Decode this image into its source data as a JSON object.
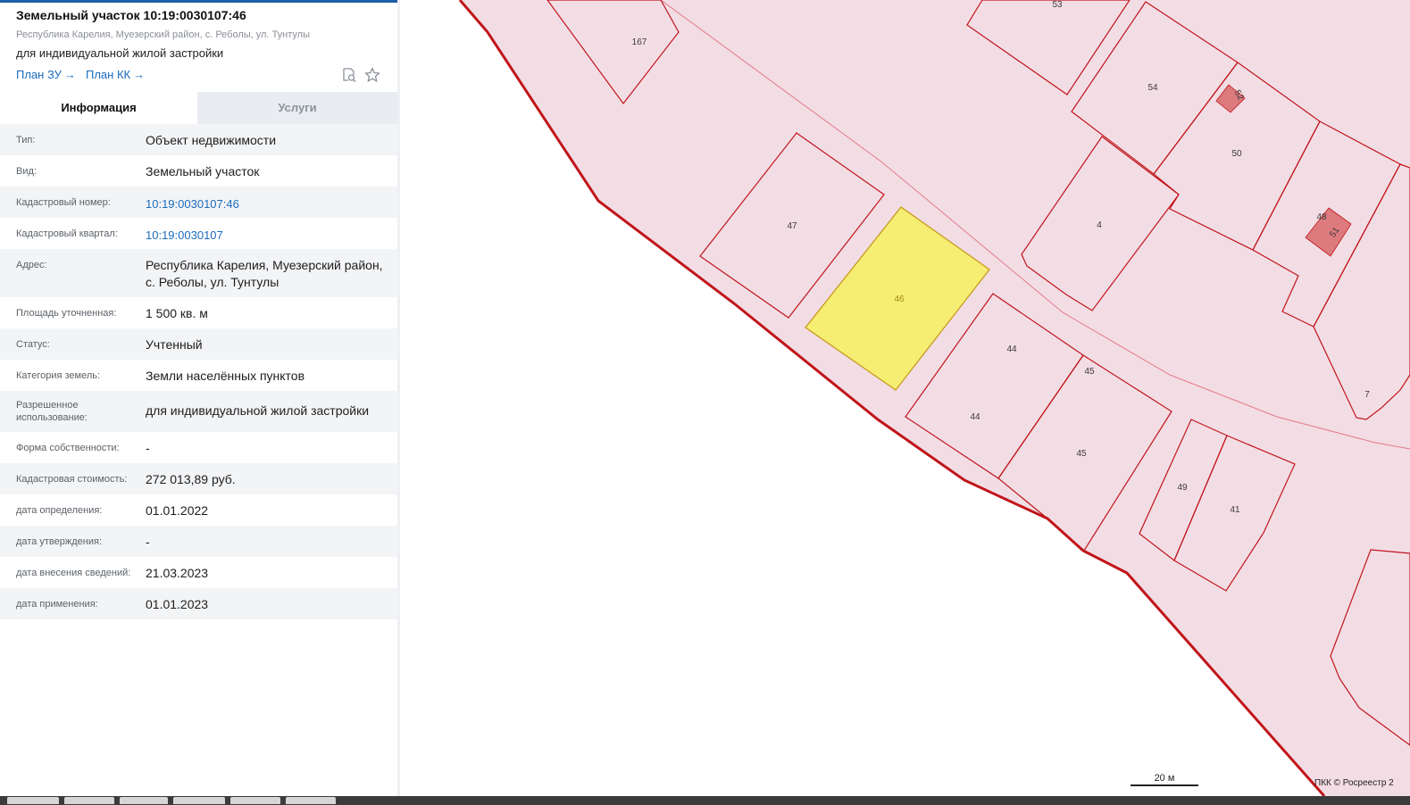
{
  "header": {
    "title": "Земельный участок 10:19:0030107:46",
    "address": "Республика Карелия, Муезерский район, с. Реболы, ул. Тунтулы",
    "use": "для индивидуальной жилой застройки",
    "link_plan_zu": "План ЗУ",
    "link_plan_kk": "План КК",
    "arrow": "→",
    "icons": [
      "search-document-icon",
      "star-icon"
    ]
  },
  "tabs": {
    "info": "Информация",
    "services": "Услуги"
  },
  "info_rows": [
    {
      "label": "Тип:",
      "value": "Объект недвижимости",
      "link": false
    },
    {
      "label": "Вид:",
      "value": "Земельный участок",
      "link": false
    },
    {
      "label": "Кадастровый номер:",
      "value": "10:19:0030107:46",
      "link": true
    },
    {
      "label": "Кадастровый квартал:",
      "value": "10:19:0030107",
      "link": true
    },
    {
      "label": "Адрес:",
      "value": "Республика Карелия, Муезерский район, с. Реболы, ул. Тунтулы",
      "link": false
    },
    {
      "label": "Площадь уточненная:",
      "value": "1 500 кв. м",
      "link": false
    },
    {
      "label": "Статус:",
      "value": "Учтенный",
      "link": false
    },
    {
      "label": "Категория земель:",
      "value": "Земли населённых пунктов",
      "link": false
    },
    {
      "label": "Разрешенное использование:",
      "value": "для индивидуальной жилой застройки",
      "link": false
    },
    {
      "label": "Форма собственности:",
      "value": "-",
      "link": false
    },
    {
      "label": "Кадастровая стоимость:",
      "value": "272 013,89 руб.",
      "link": false
    },
    {
      "label": "дата определения:",
      "value": "01.01.2022",
      "link": false
    },
    {
      "label": "дата утверждения:",
      "value": "-",
      "link": false
    },
    {
      "label": "дата внесения сведений:",
      "value": "21.03.2023",
      "link": false
    },
    {
      "label": "дата применения:",
      "value": "01.01.2023",
      "link": false
    }
  ],
  "map": {
    "plot_labels": [
      "167",
      "53",
      "54",
      "52",
      "50",
      "47",
      "46",
      "4",
      "48",
      "51",
      "44",
      "45",
      "44",
      "45",
      "7",
      "49",
      "41"
    ],
    "scale_label": "20 м",
    "copyright": "ПКК © Росреестр 2",
    "colors": {
      "quarter_fill": "#f3dde5",
      "boundary": "#c0151a",
      "selected_fill": "#f6ee72",
      "building_fill": "#dd7a7e"
    }
  }
}
